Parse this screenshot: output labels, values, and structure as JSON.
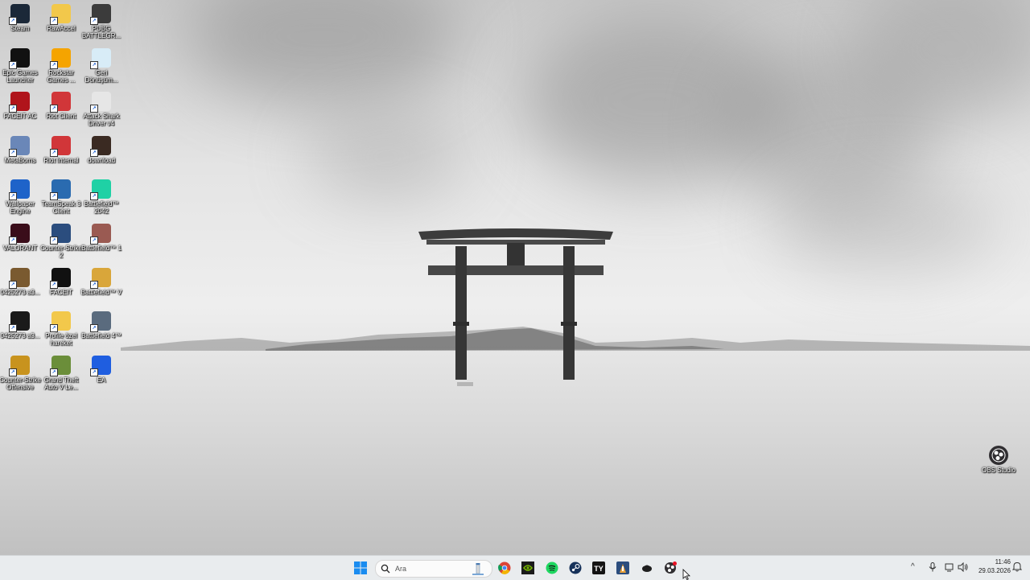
{
  "desktop": {
    "icons": [
      {
        "label": "Steam",
        "icon": "steam-icon",
        "color": "#1b2838"
      },
      {
        "label": "RawAccel",
        "icon": "folder-icon",
        "color": "#f2c84b"
      },
      {
        "label": "PUBG BATTLEGR...",
        "icon": "pubg-icon",
        "color": "#3b3b3b"
      },
      {
        "label": "Epic Games Launcher",
        "icon": "epic-games-icon",
        "color": "#111111"
      },
      {
        "label": "Rockstar Games ...",
        "icon": "rockstar-icon",
        "color": "#f5a400"
      },
      {
        "label": "Geri Dönüşüm...",
        "icon": "recycle-bin-icon",
        "color": "#d8ecf7"
      },
      {
        "label": "FACEIT AC",
        "icon": "faceit-ac-icon",
        "color": "#b0141b"
      },
      {
        "label": "Riot Client",
        "icon": "riot-client-icon",
        "color": "#d13639"
      },
      {
        "label": "Attack Shark Driver v4",
        "icon": "attack-shark-icon",
        "color": "#e6e6e6"
      },
      {
        "label": "MetaBorns",
        "icon": "metaborns-icon",
        "color": "#6a87b8"
      },
      {
        "label": "Riot Internal",
        "icon": "riot-internal-icon",
        "color": "#d13639"
      },
      {
        "label": "download",
        "icon": "image-file-icon",
        "color": "#3a2a22"
      },
      {
        "label": "Wallpaper Engine",
        "icon": "wallpaper-engine-icon",
        "color": "#1e63c9"
      },
      {
        "label": "TeamSpeak 3 Client",
        "icon": "teamspeak-icon",
        "color": "#2a6bb0"
      },
      {
        "label": "Battlefield™ 2042",
        "icon": "battlefield-2042-icon",
        "color": "#1fd1a5"
      },
      {
        "label": "VALORANT",
        "icon": "valorant-icon",
        "color": "#3a0d1a"
      },
      {
        "label": "Counter-Strike 2",
        "icon": "counter-strike-2-icon",
        "color": "#2b4d7e"
      },
      {
        "label": "Battlefield™ 1",
        "icon": "battlefield-1-icon",
        "color": "#9a5a52"
      },
      {
        "label": "0425273 a3...",
        "icon": "image-file-icon",
        "color": "#7a5a30"
      },
      {
        "label": "FACEIT",
        "icon": "faceit-icon",
        "color": "#111111"
      },
      {
        "label": "Battlefield™ V",
        "icon": "battlefield-v-icon",
        "color": "#d9a63a"
      },
      {
        "label": "0425273 a3...",
        "icon": "video-file-icon",
        "color": "#1a1a1a"
      },
      {
        "label": "Profile özel hareket",
        "icon": "folder-icon",
        "color": "#f2c84b"
      },
      {
        "label": "Battlefield 4™",
        "icon": "battlefield-4-icon",
        "color": "#5a6b7e"
      },
      {
        "label": "Counter-Strike Offensive",
        "icon": "cs-go-icon",
        "color": "#c8931e"
      },
      {
        "label": "Grand Theft Auto V Le...",
        "icon": "gta-v-icon",
        "color": "#6b8e3a"
      },
      {
        "label": "EA",
        "icon": "ea-icon",
        "color": "#1f5ee0"
      }
    ],
    "obs": {
      "label": "OBS Studio",
      "icon": "obs-studio-icon",
      "color": "#302e31"
    }
  },
  "taskbar": {
    "search_placeholder": "Ara",
    "apps": [
      {
        "name": "start-button",
        "icon": "windows-start-icon"
      },
      {
        "name": "chrome",
        "icon": "chrome-icon"
      },
      {
        "name": "nvidia",
        "icon": "nvidia-icon"
      },
      {
        "name": "spotify",
        "icon": "spotify-icon"
      },
      {
        "name": "steam",
        "icon": "steam-icon"
      },
      {
        "name": "faceit",
        "icon": "faceit-icon"
      },
      {
        "name": "counter-strike-2",
        "icon": "counter-strike-2-icon"
      },
      {
        "name": "discord-alt",
        "icon": "app-icon"
      },
      {
        "name": "obs-studio",
        "icon": "obs-studio-icon"
      }
    ],
    "clock": {
      "time": "11:46",
      "date": "29.03.2026"
    }
  }
}
